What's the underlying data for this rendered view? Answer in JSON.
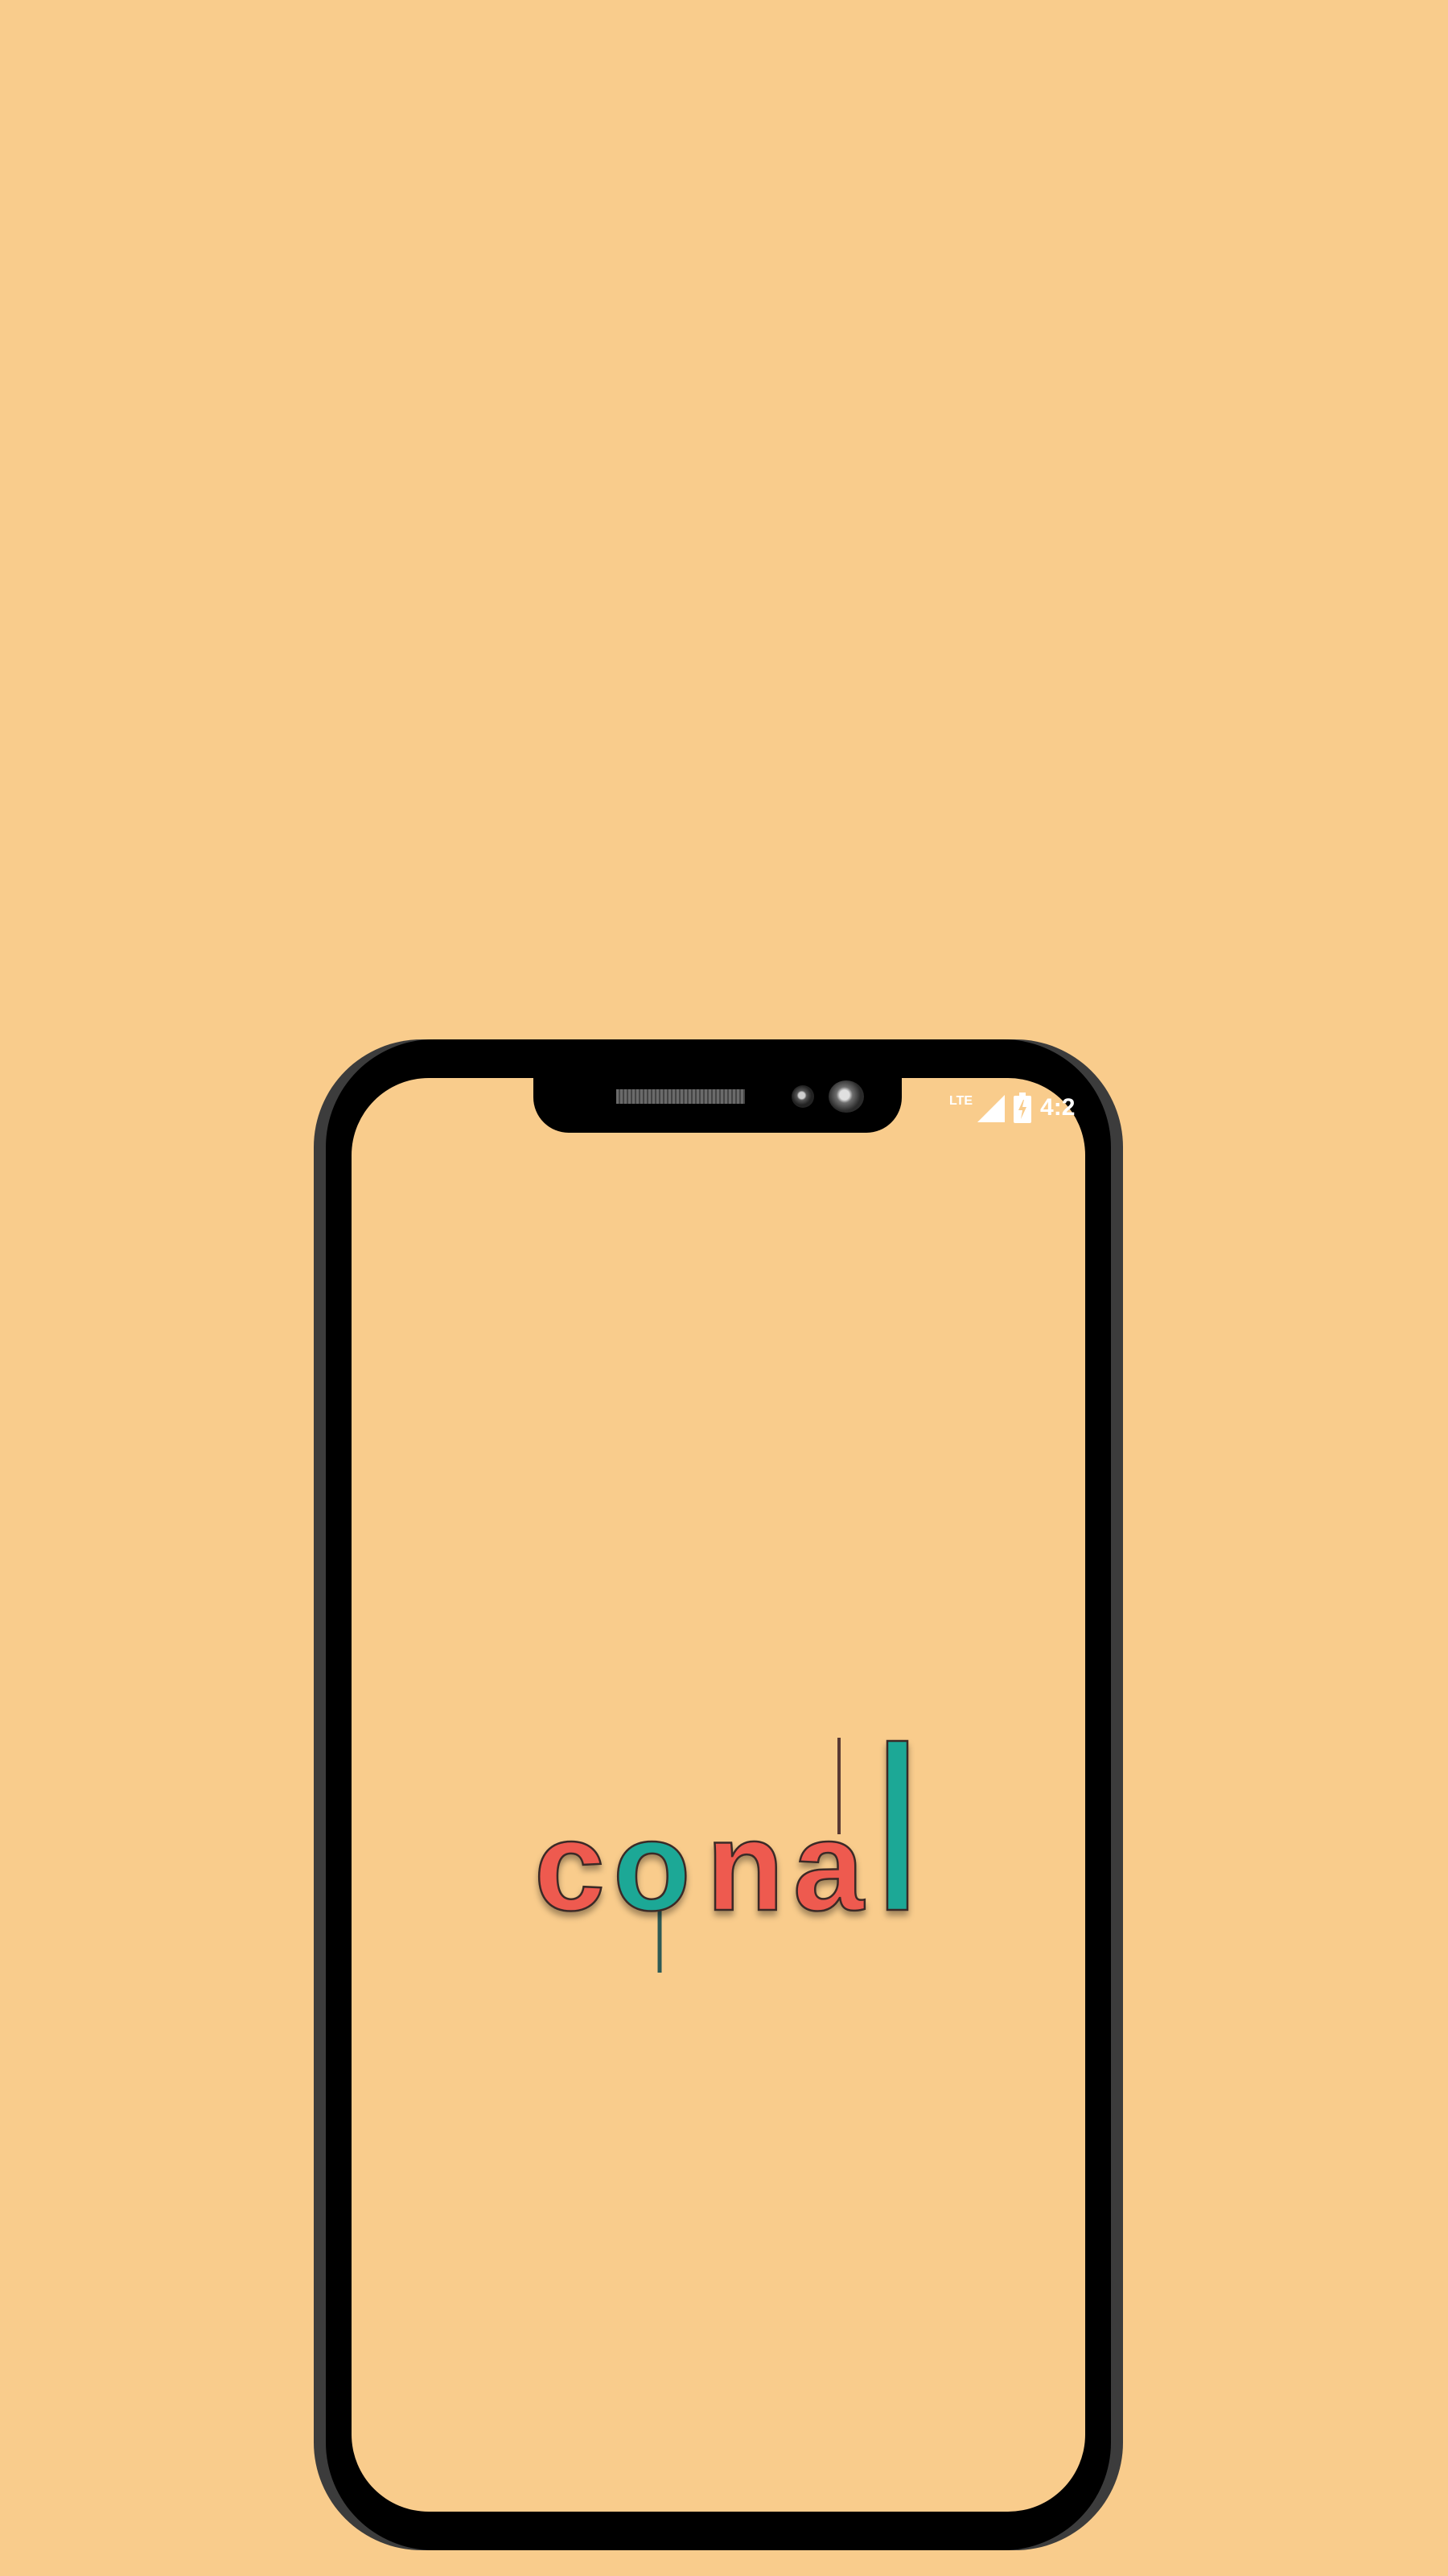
{
  "status_bar": {
    "network": "LTE",
    "time": "4:2"
  },
  "logo": {
    "letters": [
      "c",
      "o",
      "n",
      "a",
      "l"
    ],
    "colors": {
      "c": "#ee5a4f",
      "o": "#1ea896",
      "n": "#ee5a4f",
      "a": "#ee5a4f",
      "l": "#1ea896"
    },
    "accent_line_color": "#5a3a33",
    "accent_teal_line_color": "#2e5a55"
  },
  "background_color": "#f9cc8c",
  "frame_color": "#000000"
}
